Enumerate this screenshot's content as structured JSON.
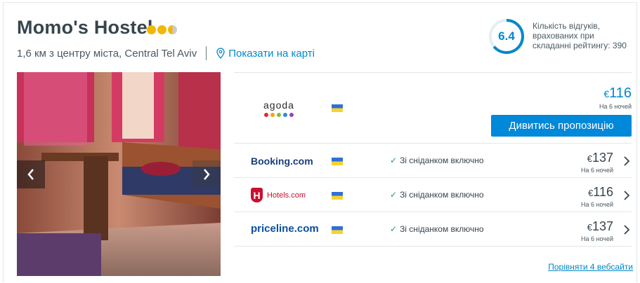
{
  "hotel": {
    "name": "Momo's Hostel",
    "star_rating": 2.5,
    "distance": "1,6 км з центру міста, Central Tel Aviv",
    "map_link": "Показати на карті"
  },
  "rating": {
    "score": "6.4",
    "score_fraction": 0.64,
    "reviews_text": "Кількість відгуків, врахованих при складанні рейтингу: 390"
  },
  "top_offer": {
    "provider": "agoda",
    "currency": "€",
    "price": "116",
    "nights": "На 6 ночей",
    "cta": "Дивитись пропозицію"
  },
  "offers": [
    {
      "provider": "Booking.com",
      "breakfast": "Зі сніданком включно",
      "currency": "€",
      "price": "137",
      "nights": "На 6 ночей"
    },
    {
      "provider": "Hotels.com",
      "breakfast": "Зі сніданком включно",
      "currency": "€",
      "price": "116",
      "nights": "На 6 ночей"
    },
    {
      "provider": "priceline.com",
      "breakfast": "Зі сніданком включно",
      "currency": "€",
      "price": "137",
      "nights": "На 6 ночей"
    }
  ],
  "compare_link": "Порівняти 4 вебсайти",
  "colors": {
    "accent": "#0088cc",
    "button": "#0088d9",
    "star": "#f2b705",
    "check": "#1ba34a"
  },
  "agoda_dot_colors": [
    "#e22b2b",
    "#f7a21b",
    "#7bc043",
    "#2d8ce0",
    "#9a3fbf"
  ]
}
